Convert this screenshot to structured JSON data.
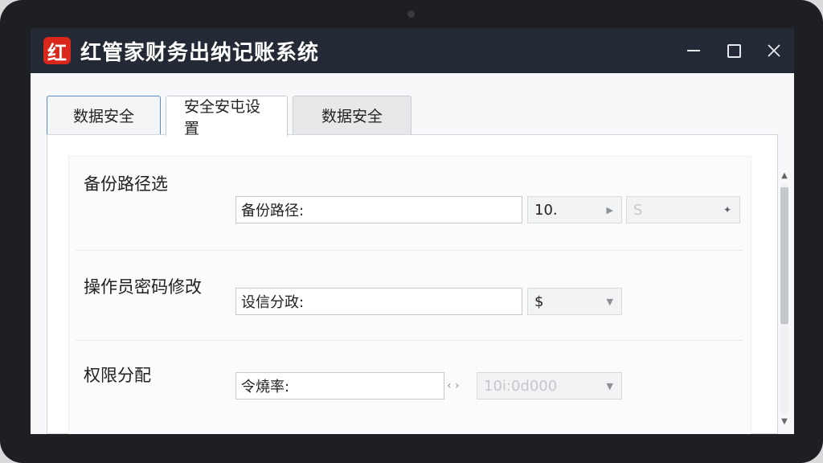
{
  "window": {
    "icon_text": "红",
    "title": "红管家财务出纳记账系统"
  },
  "tabs": [
    {
      "label": "数据安全"
    },
    {
      "label": "安全安屯设置"
    },
    {
      "label": "数据安全"
    }
  ],
  "sections": {
    "backup": {
      "title": "备份路径选",
      "path_field_value": "备份路径:",
      "select1_value": "10.",
      "select2_value": "S"
    },
    "password": {
      "title": "操作员密码修改",
      "field_value": "设信分政:",
      "select_value": "$"
    },
    "permissions": {
      "title": "权限分配",
      "field_value": "令燒率:",
      "select_value": "10i:0d000"
    }
  },
  "icons": {
    "minimize": "minimize-icon",
    "maximize": "maximize-icon",
    "close": "close-icon"
  },
  "colors": {
    "titlebar": "#232a35",
    "app_icon": "#d9271c",
    "active_tab_border": "#5a8ac8"
  }
}
